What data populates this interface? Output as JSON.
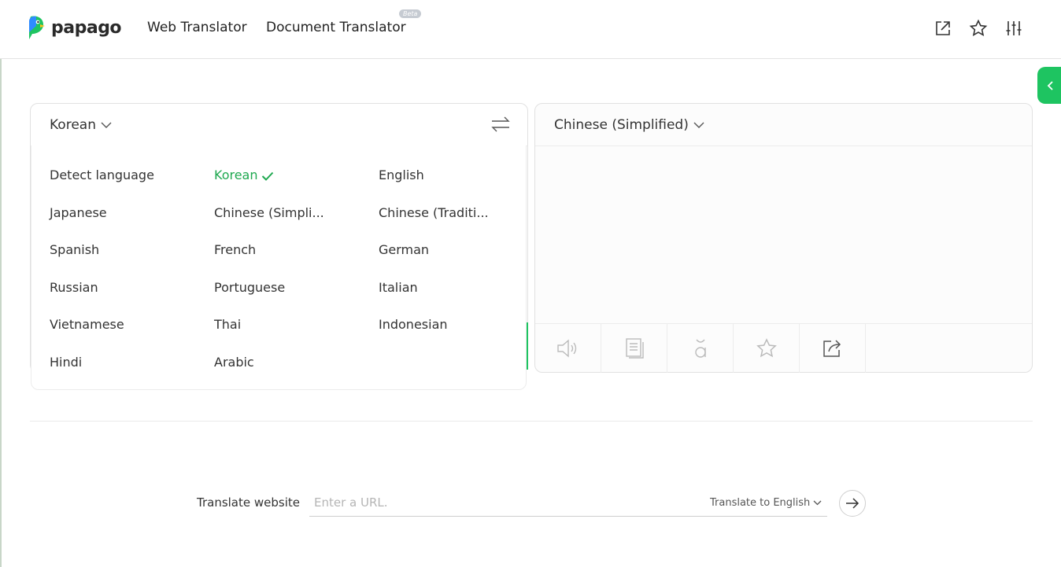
{
  "header": {
    "logo_text": "papago",
    "nav": [
      {
        "label": "Web Translator"
      },
      {
        "label": "Document Translator",
        "badge": "Beta"
      }
    ],
    "icons": [
      "open-new-window-icon",
      "star-icon",
      "settings-sliders-icon"
    ]
  },
  "colors": {
    "accent": "#1ec461",
    "active_lang": "#1ea84f"
  },
  "source": {
    "language": "Korean",
    "languages": [
      {
        "label": "Detect language",
        "selected": false
      },
      {
        "label": "Korean",
        "selected": true
      },
      {
        "label": "English",
        "selected": false
      },
      {
        "label": "Japanese",
        "selected": false
      },
      {
        "label": "Chinese (Simpli...",
        "selected": false
      },
      {
        "label": "Chinese (Traditi...",
        "selected": false
      },
      {
        "label": "Spanish",
        "selected": false
      },
      {
        "label": "French",
        "selected": false
      },
      {
        "label": "German",
        "selected": false
      },
      {
        "label": "Russian",
        "selected": false
      },
      {
        "label": "Portuguese",
        "selected": false
      },
      {
        "label": "Italian",
        "selected": false
      },
      {
        "label": "Vietnamese",
        "selected": false
      },
      {
        "label": "Thai",
        "selected": false
      },
      {
        "label": "Indonesian",
        "selected": false
      },
      {
        "label": "Hindi",
        "selected": false
      },
      {
        "label": "Arabic",
        "selected": false
      }
    ]
  },
  "target": {
    "language": "Chinese (Simplified)",
    "tools": [
      "speaker-icon",
      "copy-icon",
      "pronunciation-icon",
      "star-icon",
      "share-icon"
    ]
  },
  "website": {
    "label": "Translate website",
    "placeholder": "Enter a URL.",
    "target_language": "Translate to English"
  }
}
